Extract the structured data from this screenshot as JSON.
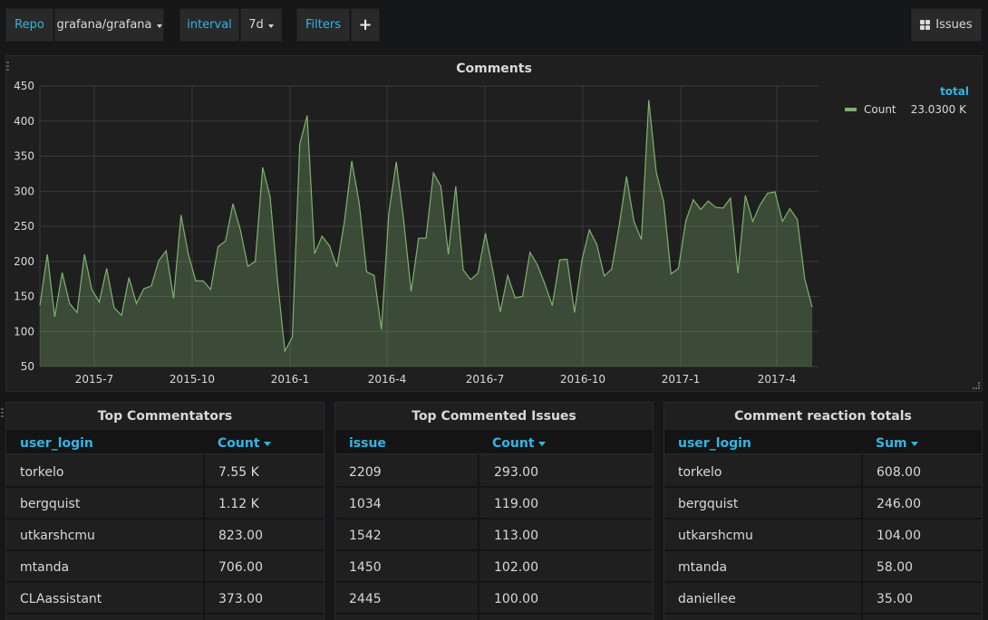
{
  "toolbar": {
    "repo_label": "Repo",
    "repo_value": "grafana/grafana",
    "interval_label": "interval",
    "interval_value": "7d",
    "filters_label": "Filters",
    "add_filter": "+",
    "issues_link": "Issues"
  },
  "chart_panel": {
    "title": "Comments",
    "legend_header": "total",
    "legend_series": "Count",
    "legend_total": "23.0300 K"
  },
  "chart_data": {
    "type": "area",
    "title": "Comments",
    "xlabel": "",
    "ylabel": "",
    "ylim": [
      50,
      450
    ],
    "yticks": [
      450,
      400,
      350,
      300,
      250,
      200,
      150,
      100,
      50
    ],
    "xticks": [
      "2015-7",
      "2015-10",
      "2016-1",
      "2016-4",
      "2016-7",
      "2016-10",
      "2017-1",
      "2017-4"
    ],
    "grid": true,
    "legend": "right",
    "series": [
      {
        "name": "Count",
        "color": "#7eb26d",
        "values": [
          137,
          210,
          121,
          184,
          140,
          127,
          210,
          160,
          142,
          190,
          134,
          123,
          177,
          140,
          161,
          165,
          201,
          215,
          147,
          266,
          210,
          172,
          172,
          160,
          221,
          229,
          282,
          245,
          193,
          200,
          334,
          292,
          172,
          72,
          92,
          367,
          408,
          211,
          236,
          222,
          192,
          256,
          343,
          283,
          185,
          180,
          103,
          269,
          342,
          258,
          157,
          233,
          233,
          326,
          307,
          210,
          307,
          188,
          174,
          183,
          240,
          187,
          128,
          180,
          148,
          150,
          213,
          195,
          168,
          137,
          202,
          203,
          127,
          202,
          245,
          224,
          179,
          189,
          250,
          321,
          257,
          231,
          430,
          327,
          285,
          182,
          190,
          258,
          288,
          274,
          286,
          277,
          276,
          290,
          183,
          294,
          257,
          281,
          297,
          299,
          257,
          275,
          260,
          175,
          135
        ]
      }
    ]
  },
  "tables": [
    {
      "title": "Top Commentators",
      "col1": "user_login",
      "col2": "Count",
      "rows": [
        [
          "torkelo",
          "7.55 K"
        ],
        [
          "bergquist",
          "1.12 K"
        ],
        [
          "utkarshcmu",
          "823.00"
        ],
        [
          "mtanda",
          "706.00"
        ],
        [
          "CLAassistant",
          "373.00"
        ]
      ]
    },
    {
      "title": "Top Commented Issues",
      "col1": "issue",
      "col2": "Count",
      "rows": [
        [
          "2209",
          "293.00"
        ],
        [
          "1034",
          "119.00"
        ],
        [
          "1542",
          "113.00"
        ],
        [
          "1450",
          "102.00"
        ],
        [
          "2445",
          "100.00"
        ]
      ]
    },
    {
      "title": "Comment reaction totals",
      "col1": "user_login",
      "col2": "Sum",
      "rows": [
        [
          "torkelo",
          "608.00"
        ],
        [
          "bergquist",
          "246.00"
        ],
        [
          "utkarshcmu",
          "104.00"
        ],
        [
          "mtanda",
          "58.00"
        ],
        [
          "daniellee",
          "35.00"
        ]
      ]
    }
  ],
  "colors": {
    "background": "#161719",
    "panel": "#1f1f20",
    "accent": "#33b5e5",
    "series": "#7eb26d"
  }
}
